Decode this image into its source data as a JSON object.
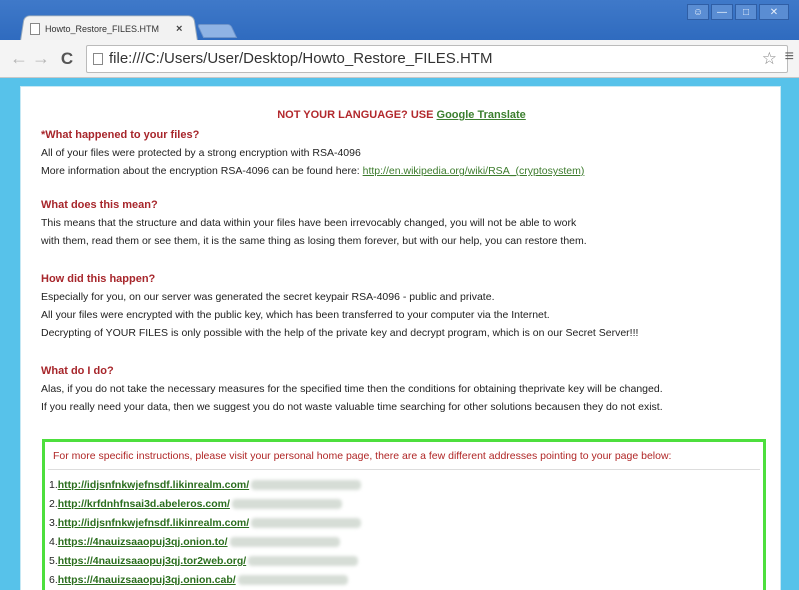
{
  "browser": {
    "tab_title": "Howto_Restore_FILES.HTM",
    "tab_close": "×",
    "url": "file:///C:/Users/User/Desktop/Howto_Restore_FILES.HTM",
    "window_controls": [
      "user",
      "minimize",
      "maximize",
      "close"
    ]
  },
  "page": {
    "lang_text": "NOT YOUR LANGUAGE? USE",
    "lang_link": "Google Translate",
    "sections": [
      {
        "heading": "*What happened to your files?",
        "lines": [
          "All of your files were protected by a strong encryption with RSA-4096"
        ],
        "info_prefix": "More information about the encryption RSA-4096 can be found here:",
        "info_link": "http://en.wikipedia.org/wiki/RSA_(cryptosystem)"
      },
      {
        "heading": "What does this mean?",
        "lines": [
          "This means that the structure and data within your files have been irrevocably changed, you will not be able to work",
          "with them, read them or see them, it is the same thing as losing them forever, but with our help, you can restore them."
        ]
      },
      {
        "heading": "How did this happen?",
        "lines": [
          "Especially for you, on our server was generated the secret keypair RSA-4096 - public and private.",
          "All your files were encrypted with the public key, which has been transferred to your computer via the Internet.",
          "Decrypting of YOUR FILES is only possible with the help of the private key and decrypt program, which is on our Secret Server!!!"
        ]
      },
      {
        "heading": "What do I do?",
        "lines": [
          "Alas, if you do not take the necessary measures for the specified time then the conditions for obtaining theprivate key will be changed.",
          "If you really need your data, then we suggest you do not waste valuable time searching for other solutions becausen they do not exist."
        ]
      }
    ],
    "instructions": "For more specific instructions, please visit your personal home page, there are a few different addresses pointing to your page below:",
    "links": [
      {
        "num": "1.",
        "url": "http://idjsnfnkwjefnsdf.likinrealm.com/"
      },
      {
        "num": "2.",
        "url": "http://krfdnhfnsai3d.abeleros.com/"
      },
      {
        "num": "3.",
        "url": "http://idjsnfnkwjefnsdf.likinrealm.com/"
      },
      {
        "num": "4.",
        "url": "https://4nauizsaaopuj3qj.onion.to/"
      },
      {
        "num": "5.",
        "url": "https://4nauizsaaopuj3qj.tor2web.org/"
      },
      {
        "num": "6.",
        "url": "https://4nauizsaaopuj3qj.onion.cab/"
      }
    ]
  },
  "colors": {
    "heading": "#a7262b",
    "link": "#2b6e1e",
    "border_blue": "#57c2ea",
    "border_green": "#4ddf3d"
  }
}
